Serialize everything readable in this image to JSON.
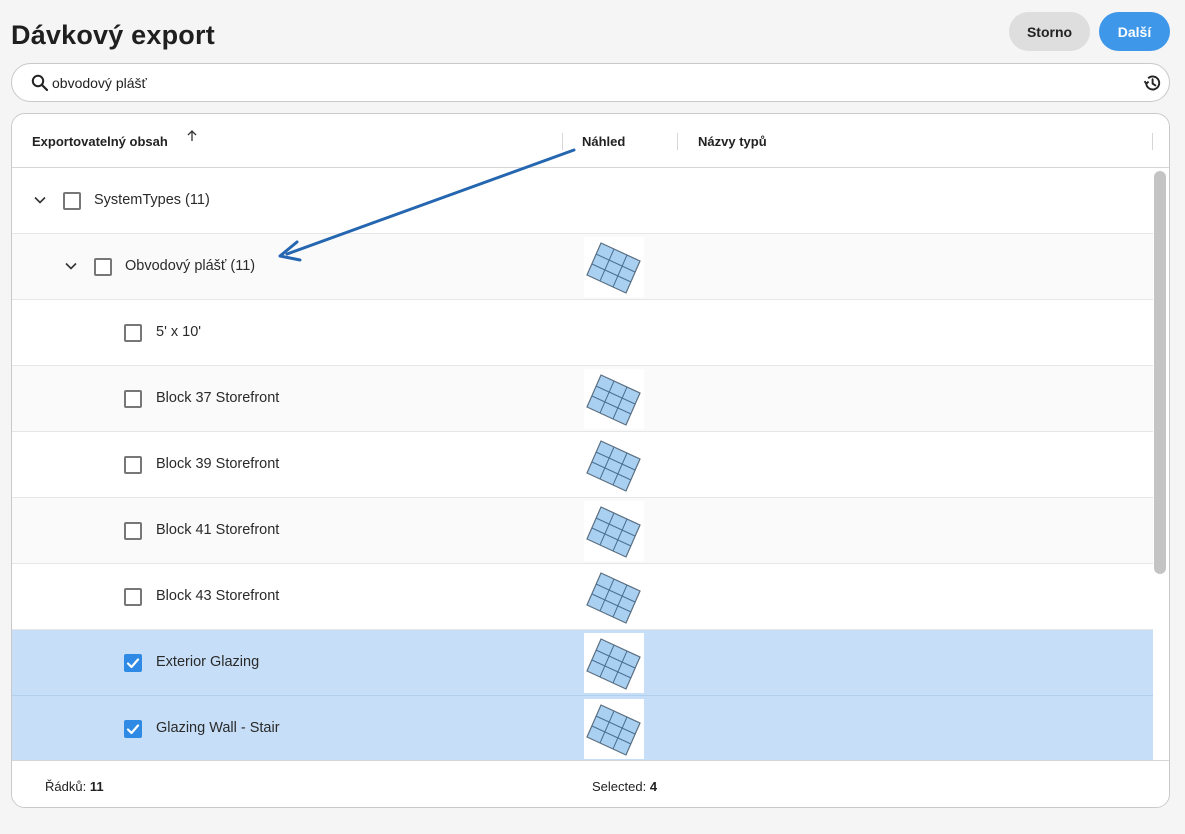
{
  "header": {
    "title": "Dávkový export",
    "cancel_label": "Storno",
    "next_label": "Další"
  },
  "search": {
    "value": "obvodový plášť",
    "search_icon": "search-icon",
    "history_icon": "history-icon"
  },
  "table": {
    "columns": {
      "content": "Exportovatelný obsah",
      "preview": "Náhled",
      "names": "Názvy typů"
    },
    "sort": "ascending",
    "rows": [
      {
        "label": "SystemTypes (11)",
        "level": 0,
        "expandable": true,
        "checked": false,
        "preview": false
      },
      {
        "label": "Obvodový plášť (11)",
        "level": 1,
        "expandable": true,
        "checked": false,
        "preview": true
      },
      {
        "label": "5' x 10'",
        "level": 2,
        "expandable": false,
        "checked": false,
        "preview": false
      },
      {
        "label": "Block 37 Storefront",
        "level": 2,
        "expandable": false,
        "checked": false,
        "preview": true
      },
      {
        "label": "Block 39 Storefront",
        "level": 2,
        "expandable": false,
        "checked": false,
        "preview": true
      },
      {
        "label": "Block 41 Storefront",
        "level": 2,
        "expandable": false,
        "checked": false,
        "preview": true
      },
      {
        "label": "Block 43 Storefront",
        "level": 2,
        "expandable": false,
        "checked": false,
        "preview": true
      },
      {
        "label": "Exterior Glazing",
        "level": 2,
        "expandable": false,
        "checked": true,
        "preview": true
      },
      {
        "label": "Glazing Wall - Stair",
        "level": 2,
        "expandable": false,
        "checked": true,
        "preview": true
      }
    ]
  },
  "footer": {
    "rows_label": "Řádků:",
    "rows_count": "11",
    "selected_label": "Selected:",
    "selected_count": "4"
  },
  "colors": {
    "accent": "#3e97e8",
    "selected_row": "#c6def7",
    "annotation_arrow": "#2566b0"
  }
}
